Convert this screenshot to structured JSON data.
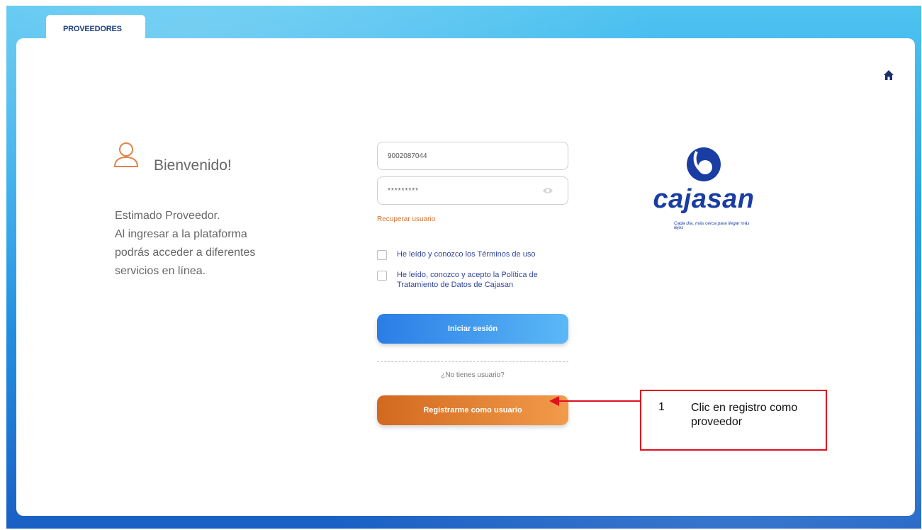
{
  "tab": {
    "label": "PROVEEDORES"
  },
  "welcome": {
    "title": "Bienvenido!",
    "message": "Estimado Proveedor.\nAl ingresar a la plataforma\npodrás acceder a diferentes\nservicios en línea."
  },
  "login": {
    "username_value": "9002087044",
    "password_value": "*********",
    "recover_label": "Recuperar usuario",
    "terms_label": "He leído y conozco los Términos de uso",
    "privacy_label": "He leído, conozco y acepto la Política de Tratamiento de Datos de Cajasan",
    "submit_label": "Iniciar sesión",
    "no_user_text": "¿No tienes usuario?",
    "register_label": "Registrarme como usuario"
  },
  "brand": {
    "name": "cajasan",
    "slogan": "Cada día, más cerca para llegar más lejos",
    "color": "#1a3da3"
  },
  "annotation": {
    "number": "1",
    "text": "Clic en registro como proveedor",
    "color": "#e0101e"
  },
  "icons": [
    "home-icon",
    "user-icon",
    "eye-icon"
  ]
}
